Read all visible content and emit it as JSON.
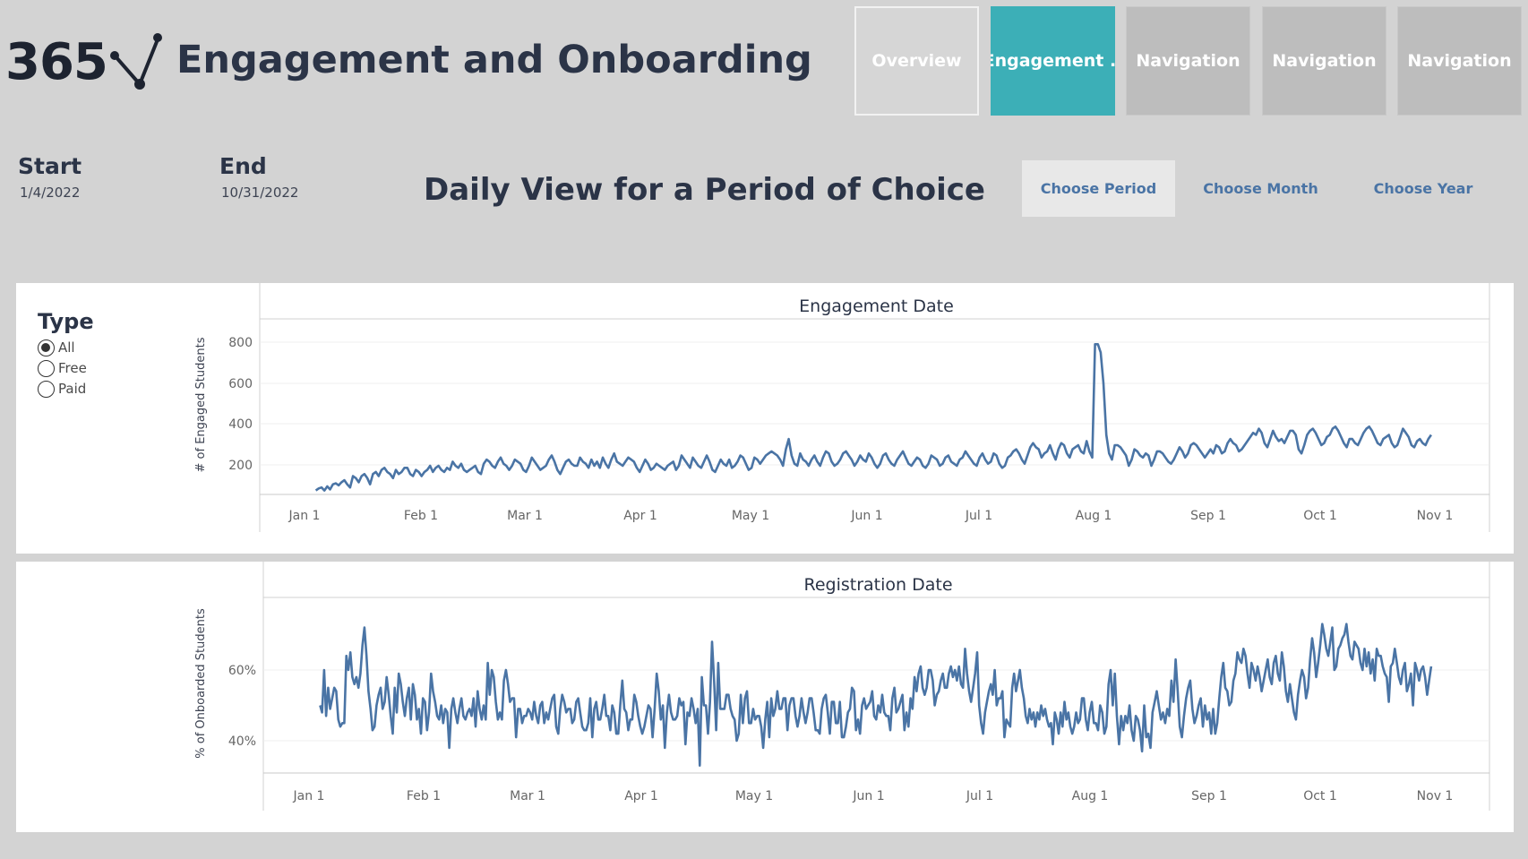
{
  "header": {
    "logo_text": "365",
    "title": "Engagement and Onboarding",
    "tabs": [
      "Overview",
      "Engagement ..",
      "Navigation",
      "Navigation",
      "Navigation"
    ],
    "active_tab": 1
  },
  "filters": {
    "start_label": "Start",
    "start_value": "1/4/2022",
    "end_label": "End",
    "end_value": "10/31/2022",
    "heading": "Daily View for a Period of Choice",
    "period_buttons": [
      "Choose Period",
      "Choose Month",
      "Choose Year"
    ],
    "selected_button": 0
  },
  "type_filter": {
    "title": "Type",
    "options": [
      "All",
      "Free",
      "Paid"
    ],
    "selected": 0
  },
  "colors": {
    "accent_tab": "#3cafb7",
    "line": "#4a74a5",
    "text": "#2b3447"
  },
  "chart_data": [
    {
      "type": "line",
      "title": "Engagement Date",
      "ylabel": "# of Engaged Students",
      "x_ticks": [
        "Jan 1",
        "Feb 1",
        "Mar 1",
        "Apr 1",
        "May 1",
        "Jun 1",
        "Jul 1",
        "Aug 1",
        "Sep 1",
        "Oct 1",
        "Nov 1"
      ],
      "y_ticks": [
        "200",
        "400",
        "600",
        "800"
      ],
      "ylim": [
        0,
        800
      ],
      "x_start": "2022-01-04",
      "x_end": "2022-10-31",
      "grid": true,
      "series": [
        {
          "values": [
            80,
            90,
            95,
            80,
            100,
            85,
            110,
            115,
            105,
            120,
            130,
            110,
            95,
            150,
            140,
            120,
            150,
            160,
            140,
            110,
            160,
            170,
            150,
            180,
            190,
            170,
            160,
            140,
            180,
            160,
            170,
            190,
            190,
            160,
            150,
            180,
            170,
            150,
            170,
            180,
            200,
            170,
            190,
            200,
            180,
            170,
            190,
            180,
            220,
            200,
            190,
            210,
            180,
            170,
            180,
            190,
            200,
            170,
            160,
            210,
            230,
            220,
            200,
            190,
            220,
            240,
            210,
            200,
            180,
            200,
            230,
            220,
            210,
            180,
            170,
            200,
            240,
            220,
            200,
            180,
            190,
            200,
            230,
            250,
            220,
            180,
            160,
            190,
            220,
            230,
            210,
            200,
            200,
            240,
            220,
            210,
            190,
            230,
            200,
            220,
            190,
            240,
            210,
            190,
            230,
            260,
            220,
            210,
            200,
            220,
            240,
            230,
            220,
            190,
            170,
            200,
            230,
            210,
            180,
            190,
            210,
            200,
            190,
            180,
            200,
            210,
            220,
            180,
            200,
            250,
            230,
            210,
            190,
            240,
            220,
            200,
            190,
            220,
            250,
            220,
            180,
            170,
            200,
            230,
            210,
            200,
            230,
            190,
            200,
            220,
            250,
            240,
            210,
            180,
            190,
            240,
            230,
            210,
            230,
            250,
            260,
            270,
            260,
            250,
            230,
            200,
            280,
            330,
            250,
            210,
            200,
            260,
            230,
            220,
            200,
            230,
            250,
            220,
            200,
            240,
            270,
            260,
            220,
            200,
            210,
            230,
            260,
            270,
            250,
            230,
            200,
            220,
            250,
            230,
            220,
            260,
            240,
            210,
            190,
            210,
            250,
            260,
            230,
            210,
            200,
            230,
            250,
            270,
            240,
            210,
            200,
            220,
            240,
            230,
            200,
            190,
            210,
            250,
            240,
            230,
            200,
            210,
            240,
            250,
            220,
            210,
            200,
            230,
            240,
            270,
            250,
            230,
            210,
            200,
            240,
            260,
            230,
            210,
            220,
            260,
            250,
            210,
            190,
            200,
            240,
            250,
            270,
            280,
            260,
            230,
            210,
            250,
            290,
            310,
            290,
            280,
            240,
            260,
            270,
            300,
            260,
            230,
            280,
            310,
            300,
            260,
            240,
            280,
            290,
            300,
            270,
            260,
            320,
            270,
            240,
            790,
            790,
            750,
            600,
            350,
            260,
            230,
            300,
            300,
            290,
            270,
            250,
            200,
            230,
            280,
            270,
            250,
            240,
            260,
            250,
            200,
            230,
            270,
            270,
            260,
            240,
            220,
            210,
            230,
            260,
            290,
            270,
            240,
            260,
            300,
            310,
            300,
            280,
            260,
            240,
            260,
            280,
            260,
            300,
            290,
            260,
            270,
            310,
            330,
            310,
            300,
            270,
            280,
            300,
            320,
            340,
            360,
            350,
            380,
            360,
            310,
            290,
            330,
            370,
            340,
            320,
            330,
            310,
            340,
            370,
            370,
            350,
            280,
            260,
            300,
            350,
            370,
            380,
            360,
            330,
            300,
            310,
            340,
            350,
            380,
            390,
            370,
            340,
            310,
            290,
            330,
            330,
            310,
            300,
            330,
            360,
            380,
            390,
            370,
            340,
            310,
            300,
            330,
            340,
            350,
            310,
            290,
            300,
            340,
            380,
            360,
            340,
            300,
            290,
            320,
            330,
            310,
            300,
            330,
            350
          ],
          "note": "daily values"
        }
      ]
    },
    {
      "type": "line",
      "title": "Registration Date",
      "ylabel": "% of Onboarded Students",
      "x_ticks": [
        "Jan 1",
        "Feb 1",
        "Mar 1",
        "Apr 1",
        "May 1",
        "Jun 1",
        "Jul 1",
        "Aug 1",
        "Sep 1",
        "Oct 1",
        "Nov 1"
      ],
      "y_ticks": [
        "40%",
        "60%"
      ],
      "ylim": [
        30,
        76
      ],
      "x_start": "2022-01-04",
      "x_end": "2022-10-31",
      "grid": true,
      "series": [
        {
          "values": [
            50,
            48,
            60,
            47,
            55,
            49,
            52,
            55,
            54,
            46,
            44,
            45,
            45,
            64,
            60,
            65,
            58,
            56,
            58,
            55,
            59,
            67,
            72,
            64,
            54,
            49,
            43,
            44,
            50,
            53,
            55,
            49,
            51,
            58,
            53,
            47,
            42,
            55,
            48,
            59,
            56,
            51,
            47,
            52,
            55,
            46,
            56,
            53,
            46,
            49,
            42,
            52,
            51,
            43,
            48,
            59,
            54,
            51,
            47,
            46,
            50,
            45,
            49,
            48,
            38,
            49,
            52,
            48,
            45,
            49,
            52,
            47,
            46,
            48,
            49,
            47,
            52,
            44,
            54,
            49,
            46,
            50,
            46,
            62,
            53,
            60,
            58,
            51,
            46,
            48,
            46,
            57,
            60,
            56,
            51,
            52,
            52,
            41,
            49,
            49,
            45,
            47,
            47,
            49,
            48,
            46,
            51,
            47,
            45,
            50,
            51,
            45,
            48,
            46,
            49,
            52,
            53,
            44,
            42,
            49,
            53,
            51,
            48,
            49,
            49,
            45,
            46,
            51,
            52,
            48,
            44,
            43,
            43,
            45,
            52,
            41,
            49,
            51,
            46,
            46,
            49,
            53,
            47,
            47,
            43,
            50,
            48,
            42,
            42,
            50,
            57,
            49,
            48,
            43,
            46,
            46,
            53,
            51,
            47,
            44,
            42,
            44,
            47,
            50,
            49,
            41,
            49,
            59,
            54,
            46,
            50,
            38,
            48,
            53,
            48,
            46,
            46,
            47,
            52,
            50,
            51,
            39,
            48,
            47,
            52,
            49,
            45,
            49,
            33,
            58,
            50,
            50,
            42,
            51,
            68,
            57,
            43,
            62,
            49,
            49,
            49,
            53,
            53,
            49,
            47,
            46,
            40,
            42,
            53,
            45,
            52,
            54,
            45,
            45,
            49,
            46,
            47,
            47,
            44,
            38,
            46,
            51,
            41,
            52,
            47,
            49,
            54,
            49,
            49,
            52,
            52,
            43,
            50,
            52,
            52,
            47,
            44,
            47,
            52,
            48,
            45,
            48,
            52,
            52,
            48,
            43,
            43,
            42,
            49,
            52,
            53,
            48,
            42,
            51,
            51,
            45,
            45,
            51,
            41,
            41,
            44,
            48,
            49,
            55,
            54,
            43,
            46,
            42,
            50,
            52,
            49,
            50,
            51,
            54,
            47,
            46,
            50,
            48,
            53,
            48,
            47,
            47,
            43,
            52,
            55,
            48,
            49,
            51,
            53,
            43,
            48,
            44,
            52,
            49,
            58,
            54,
            59,
            61,
            55,
            53,
            55,
            60,
            60,
            57,
            50,
            53,
            54,
            57,
            59,
            55,
            55,
            59,
            61,
            58,
            60,
            57,
            61,
            56,
            55,
            66,
            59,
            54,
            51,
            55,
            59,
            65,
            50,
            45,
            42,
            48,
            51,
            54,
            56,
            53,
            60,
            50,
            52,
            52,
            54,
            41,
            46,
            45,
            44,
            55,
            59,
            54,
            57,
            60,
            55,
            52,
            47,
            45,
            49,
            46,
            48,
            44,
            48,
            46,
            50,
            47,
            49,
            46,
            44,
            45,
            39,
            48,
            46,
            42,
            48,
            44,
            51,
            46,
            48,
            44,
            42,
            44,
            48,
            45,
            46,
            52,
            52,
            46,
            43,
            48,
            51,
            45,
            45,
            43,
            50,
            48,
            42,
            44,
            56,
            60,
            50,
            59,
            47,
            39,
            47,
            43,
            47,
            45,
            50,
            43,
            40,
            47,
            46,
            43,
            37,
            50,
            41,
            42,
            38,
            48,
            51,
            54,
            50,
            46,
            48,
            45,
            49,
            47,
            57,
            51,
            63,
            54,
            44,
            41,
            47,
            52,
            55,
            57,
            49,
            45,
            47,
            50,
            52,
            44,
            50,
            46,
            48,
            42,
            49,
            42,
            45,
            52,
            58,
            62,
            55,
            54,
            50,
            51,
            57,
            59,
            65,
            63,
            62,
            66,
            64,
            59,
            55,
            62,
            60,
            57,
            61,
            58,
            54,
            57,
            60,
            63,
            58,
            56,
            62,
            64,
            59,
            57,
            65,
            61,
            54,
            51,
            56,
            52,
            48,
            46,
            53,
            57,
            60,
            58,
            52,
            55,
            63,
            69,
            65,
            58,
            62,
            67,
            73,
            70,
            66,
            64,
            68,
            72,
            60,
            61,
            66,
            67,
            69,
            70,
            73,
            68,
            64,
            63,
            68,
            67,
            66,
            62,
            60,
            66,
            61,
            65,
            59,
            63,
            57,
            66,
            64,
            64,
            61,
            59,
            58,
            51,
            61,
            62,
            66,
            62,
            58,
            56,
            60,
            62,
            54,
            56,
            59,
            50,
            62,
            60,
            57,
            60,
            61,
            58,
            53,
            57,
            61
          ]
        }
      ]
    }
  ]
}
